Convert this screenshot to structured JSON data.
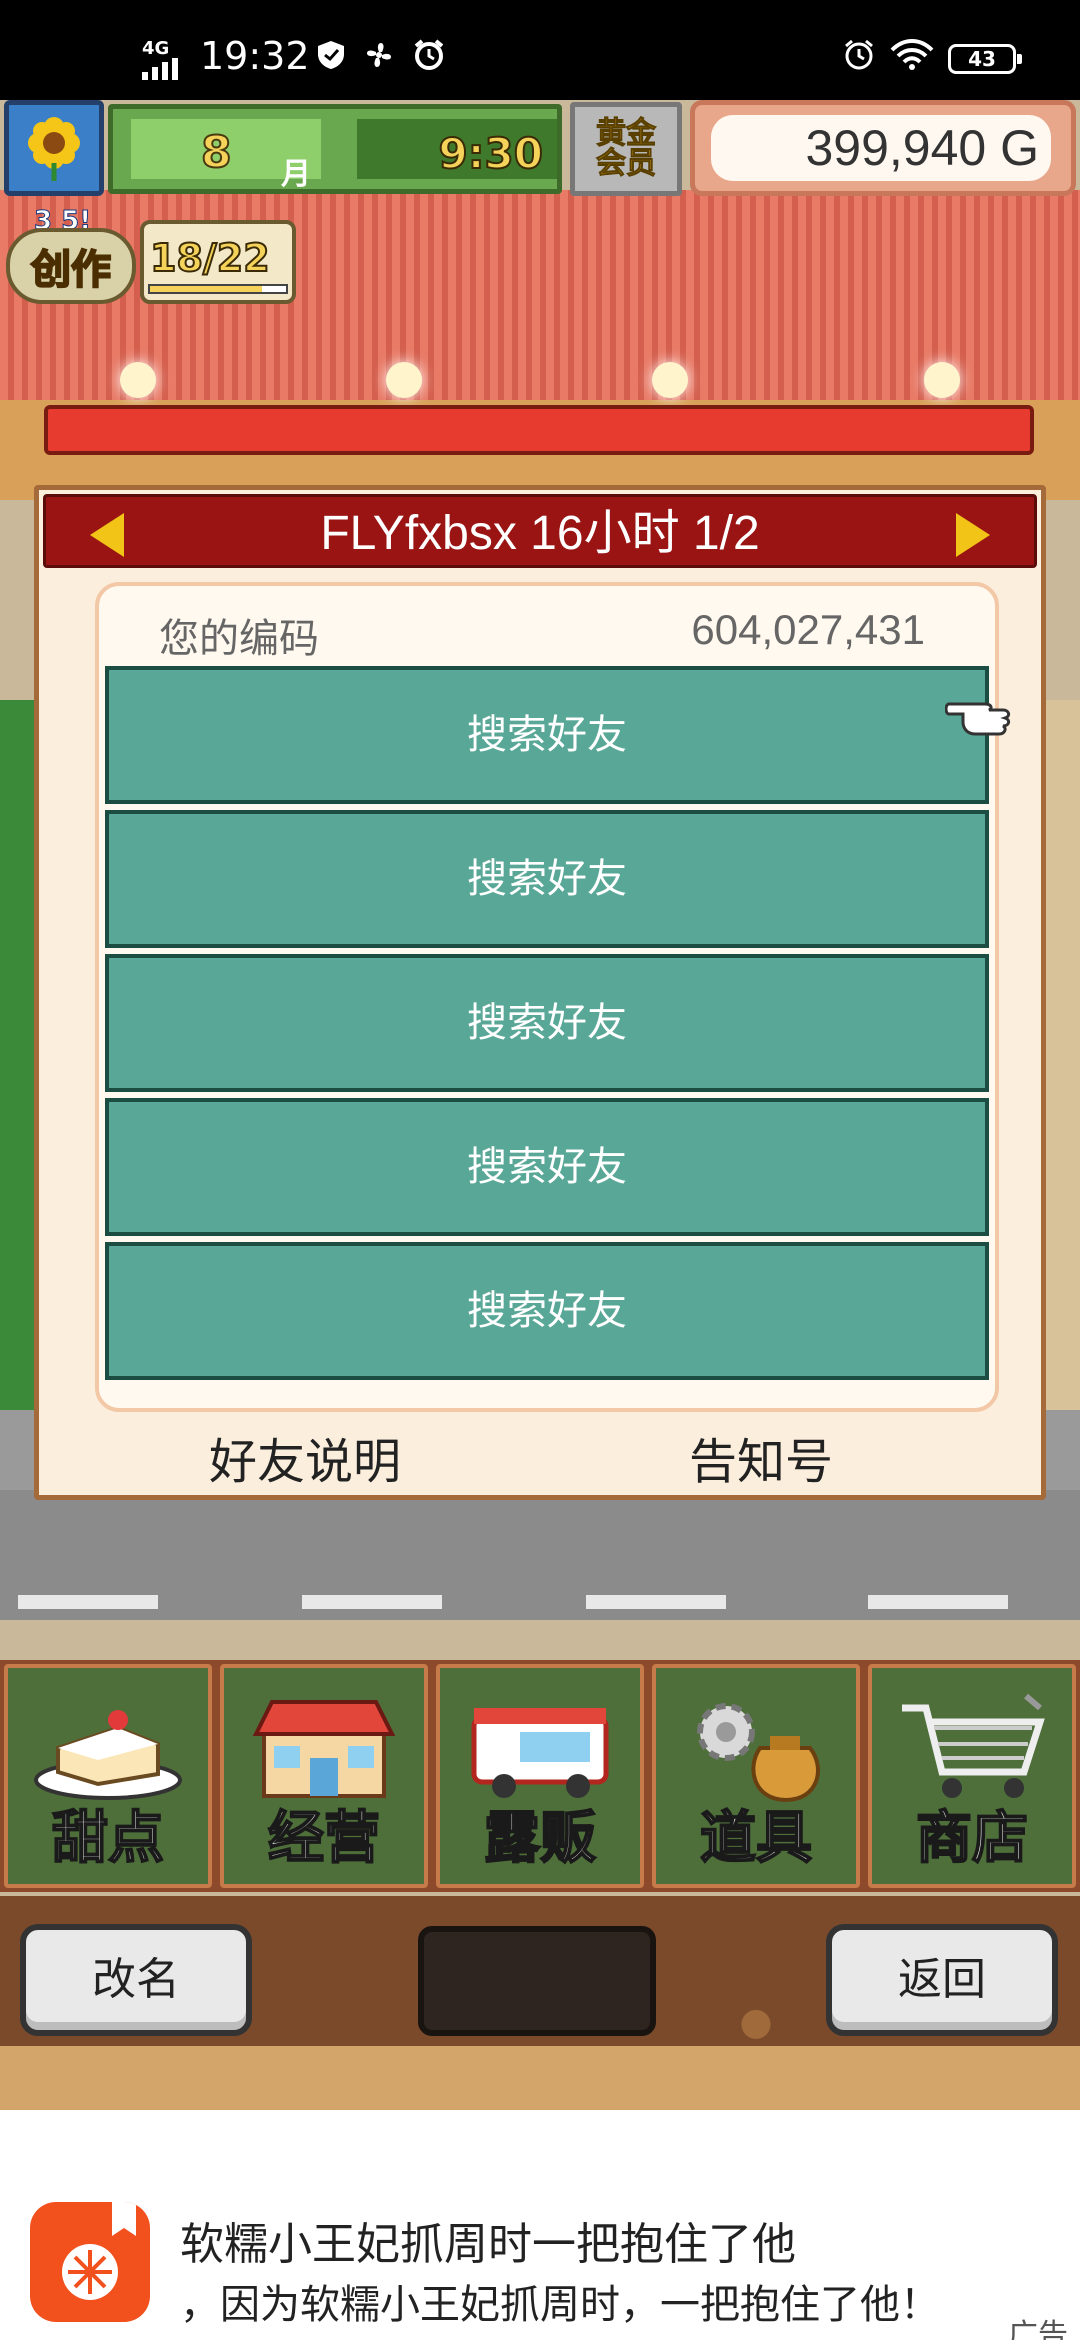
{
  "status_bar": {
    "network": "4G",
    "time": "19:32",
    "battery": "43"
  },
  "hud": {
    "month": "8",
    "month_label": "月",
    "clock": "9:30",
    "member_badge": "黄金会员",
    "gold": "399,940 G",
    "create_level": "3 5!",
    "create_label": "创作",
    "create_count": "18/22",
    "create_progress": 0.82
  },
  "dialog": {
    "title": "FLYfxbsx  16小时 1/2",
    "code_label": "您的编码",
    "code_value": "604,027,431",
    "slots": [
      {
        "label": "搜索好友"
      },
      {
        "label": "搜索好友"
      },
      {
        "label": "搜索好友"
      },
      {
        "label": "搜索好友"
      },
      {
        "label": "搜索好友"
      }
    ],
    "link_left": "好友说明",
    "link_right": "告知号"
  },
  "menu": {
    "items": [
      {
        "label": "甜点",
        "icon": "cake-icon"
      },
      {
        "label": "经营",
        "icon": "shop-icon"
      },
      {
        "label": "露贩",
        "icon": "food-truck-icon"
      },
      {
        "label": "道具",
        "icon": "gear-bag-icon"
      },
      {
        "label": "商店",
        "icon": "cart-icon"
      }
    ]
  },
  "actions": {
    "rename": "改名",
    "back": "返回"
  },
  "ad": {
    "title": "软糯小王妃抓周时一把抱住了他",
    "subtitle": "，因为软糯小王妃抓周时，一把抱住了他！",
    "tag": "广告"
  },
  "colors": {
    "dialog_header": "#9b1414",
    "slot": "#58a797",
    "menu_bg": "#8d4a2a"
  }
}
